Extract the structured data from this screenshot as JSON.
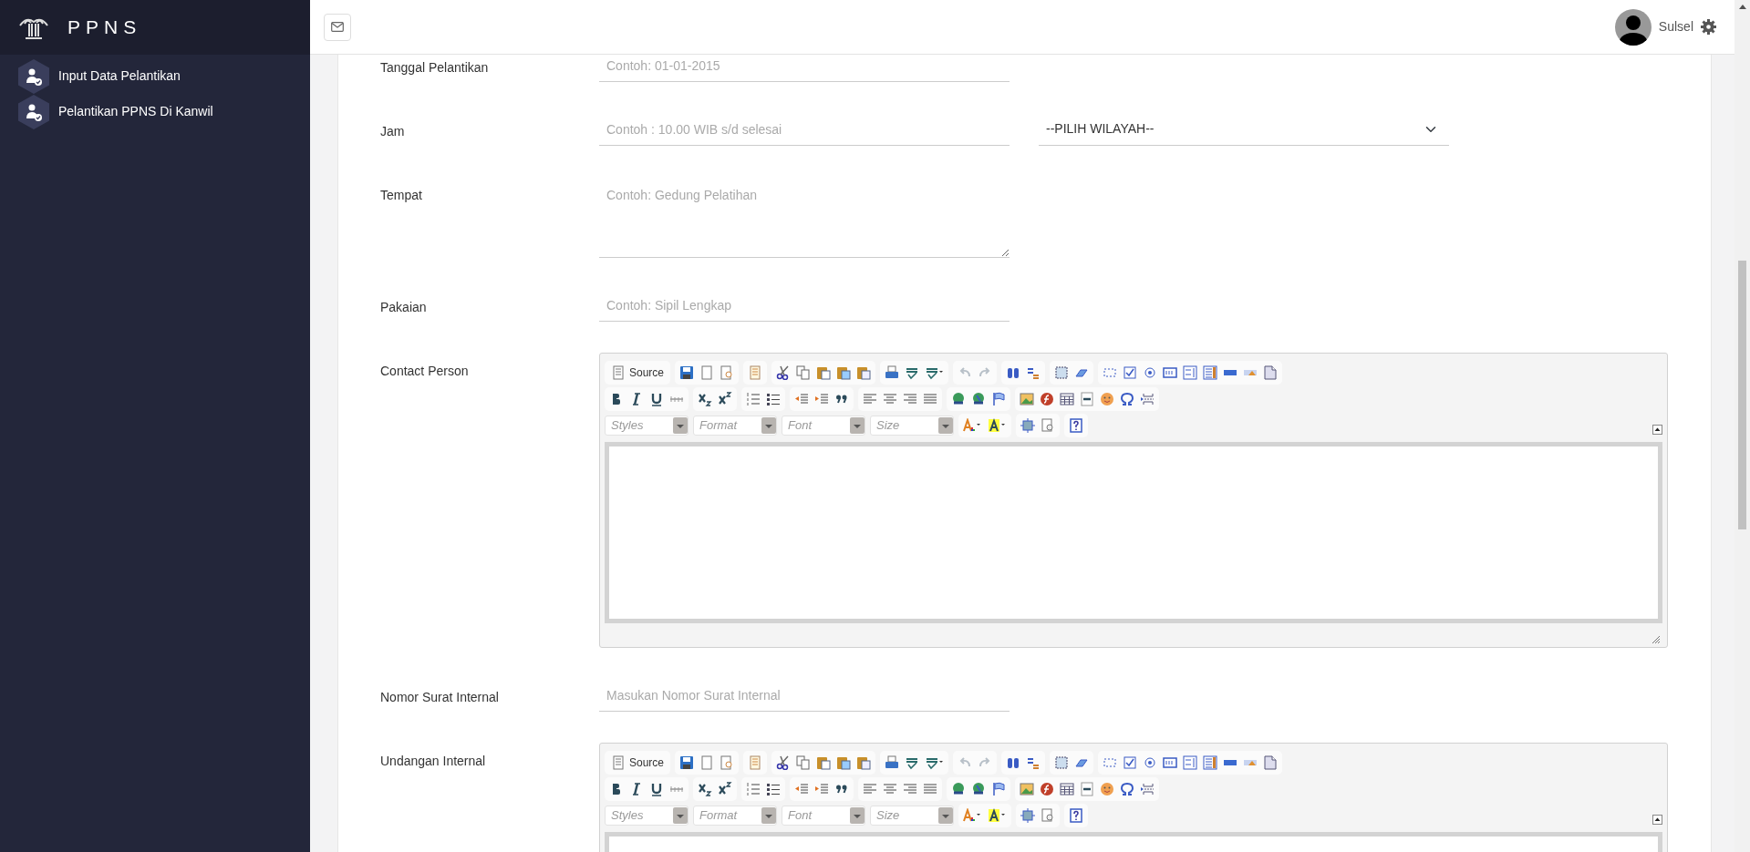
{
  "sidebar": {
    "brand": "PPNS",
    "items": [
      {
        "label": "Input Data Pelantikan"
      },
      {
        "label": "Pelantikan PPNS Di Kanwil"
      }
    ]
  },
  "topbar": {
    "user": "Sulsel"
  },
  "form": {
    "fields": [
      {
        "kind": "input",
        "label": "Tanggal Pelantikan",
        "placeholder": "Contoh: 01-01-2015"
      },
      {
        "kind": "input",
        "label": "Jam",
        "placeholder": "Contoh : 10.00 WIB s/d selesai",
        "select": "--PILIH WILAYAH--"
      },
      {
        "kind": "textarea",
        "label": "Tempat",
        "placeholder": "Contoh: Gedung Pelatihan"
      },
      {
        "kind": "input",
        "label": "Pakaian",
        "placeholder": "Contoh: Sipil Lengkap"
      },
      {
        "kind": "editor",
        "label": "Contact Person",
        "source": "Source",
        "combos": [
          "Styles",
          "Format",
          "Font",
          "Size"
        ]
      },
      {
        "kind": "input",
        "label": "Nomor Surat Internal",
        "placeholder": "Masukan Nomor Surat Internal"
      },
      {
        "kind": "editor",
        "label": "Undangan Internal",
        "source": "Source",
        "combos": [
          "Styles",
          "Format",
          "Font",
          "Size"
        ]
      }
    ]
  }
}
